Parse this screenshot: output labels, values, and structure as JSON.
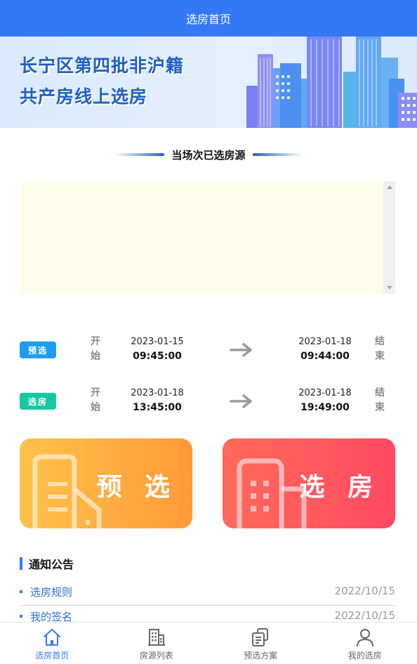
{
  "header": {
    "title": "选房首页"
  },
  "banner": {
    "line1": "长宁区第四批非沪籍",
    "line2": "共产房线上选房"
  },
  "sold_section": {
    "title": "当场次已选房源"
  },
  "schedules": [
    {
      "tag": "预选",
      "tag_color": "#1e9cf0",
      "start_label": "开始",
      "start_date": "2023-01-15",
      "start_time": "09:45:00",
      "end_date": "2023-01-18",
      "end_time": "09:44:00",
      "end_label": "结束"
    },
    {
      "tag": "选房",
      "tag_color": "#17c9a3",
      "start_label": "开始",
      "start_date": "2023-01-18",
      "start_time": "13:45:00",
      "end_date": "2023-01-18",
      "end_time": "19:49:00",
      "end_label": "结束"
    }
  ],
  "actions": {
    "preselect": "预 选",
    "select": "选 房"
  },
  "notices": {
    "title": "通知公告",
    "items": [
      {
        "title": "选房规则",
        "date": "2022/10/15"
      },
      {
        "title": "我的签名",
        "date": "2022/10/15"
      }
    ]
  },
  "tabbar": [
    {
      "label": "选房首页",
      "icon": "home-icon",
      "active": true
    },
    {
      "label": "房源列表",
      "icon": "building-icon",
      "active": false
    },
    {
      "label": "预选方案",
      "icon": "document-icon",
      "active": false
    },
    {
      "label": "我的选房",
      "icon": "user-icon",
      "active": false
    }
  ],
  "colors": {
    "primary": "#3478f6",
    "preselect_gradient": [
      "#ffc24a",
      "#ff9a38"
    ],
    "select_gradient": [
      "#ff6a5a",
      "#ff4a62"
    ]
  }
}
